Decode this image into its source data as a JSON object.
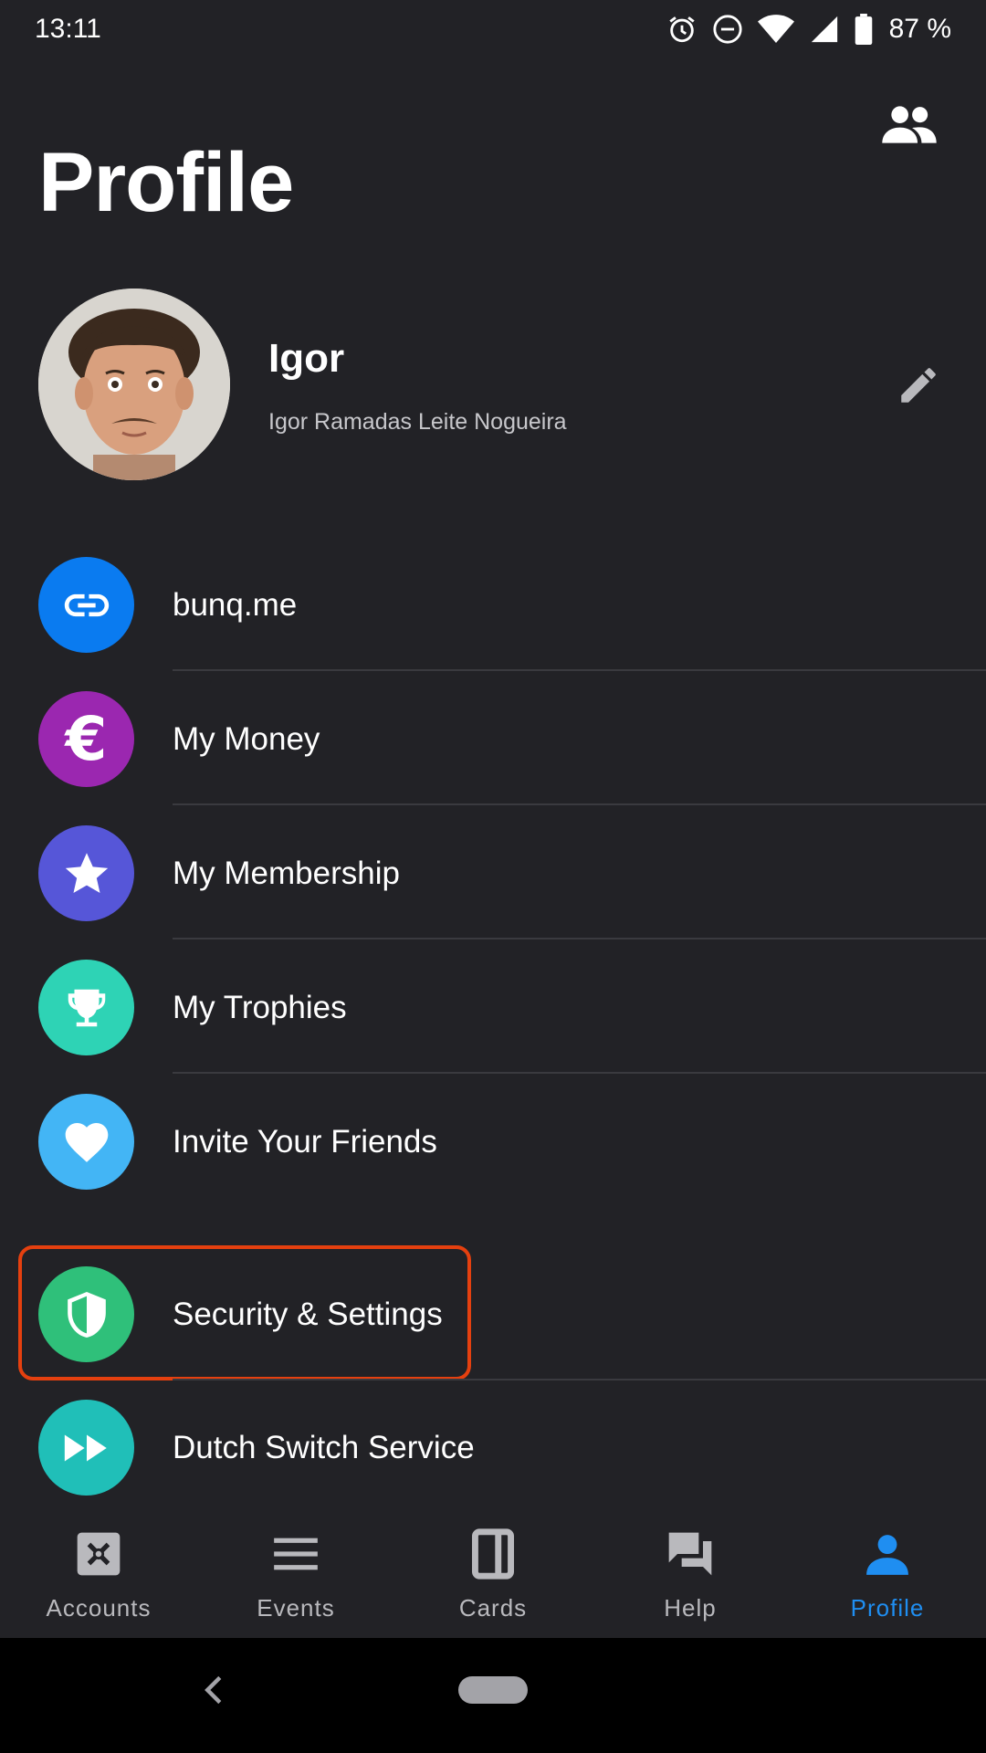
{
  "status_bar": {
    "time": "13:11",
    "battery": "87 %",
    "icons": [
      "alarm-icon",
      "do-not-disturb-icon",
      "wifi-icon",
      "signal-icon",
      "battery-icon"
    ]
  },
  "header": {
    "title": "Profile",
    "contacts_icon": "people-icon"
  },
  "profile": {
    "name": "Igor",
    "full_name": "Igor Ramadas Leite Nogueira",
    "edit_icon": "pencil-icon"
  },
  "menu": {
    "items": [
      {
        "label": "bunq.me",
        "icon": "link-icon",
        "color": "#0a7bf0"
      },
      {
        "label": "My Money",
        "icon": "euro-icon",
        "color": "#9b27b0"
      },
      {
        "label": "My Membership",
        "icon": "star-icon",
        "color": "#5656d8"
      },
      {
        "label": "My Trophies",
        "icon": "trophy-icon",
        "color": "#2ed3b5"
      },
      {
        "label": "Invite Your Friends",
        "icon": "heart-icon",
        "color": "#43b5f5"
      },
      {
        "label": "Security & Settings",
        "icon": "shield-icon",
        "color": "#2fc07a"
      },
      {
        "label": "Dutch Switch Service",
        "icon": "fast-forward-icon",
        "color": "#20bfb8"
      }
    ]
  },
  "highlight_color": "#e5400f",
  "bottom_nav": {
    "active_color": "#1f8ef1",
    "tabs": [
      {
        "label": "Accounts",
        "icon": "vault-icon"
      },
      {
        "label": "Events",
        "icon": "list-icon"
      },
      {
        "label": "Cards",
        "icon": "card-icon"
      },
      {
        "label": "Help",
        "icon": "chat-icon"
      },
      {
        "label": "Profile",
        "icon": "person-icon",
        "active": true
      }
    ]
  }
}
